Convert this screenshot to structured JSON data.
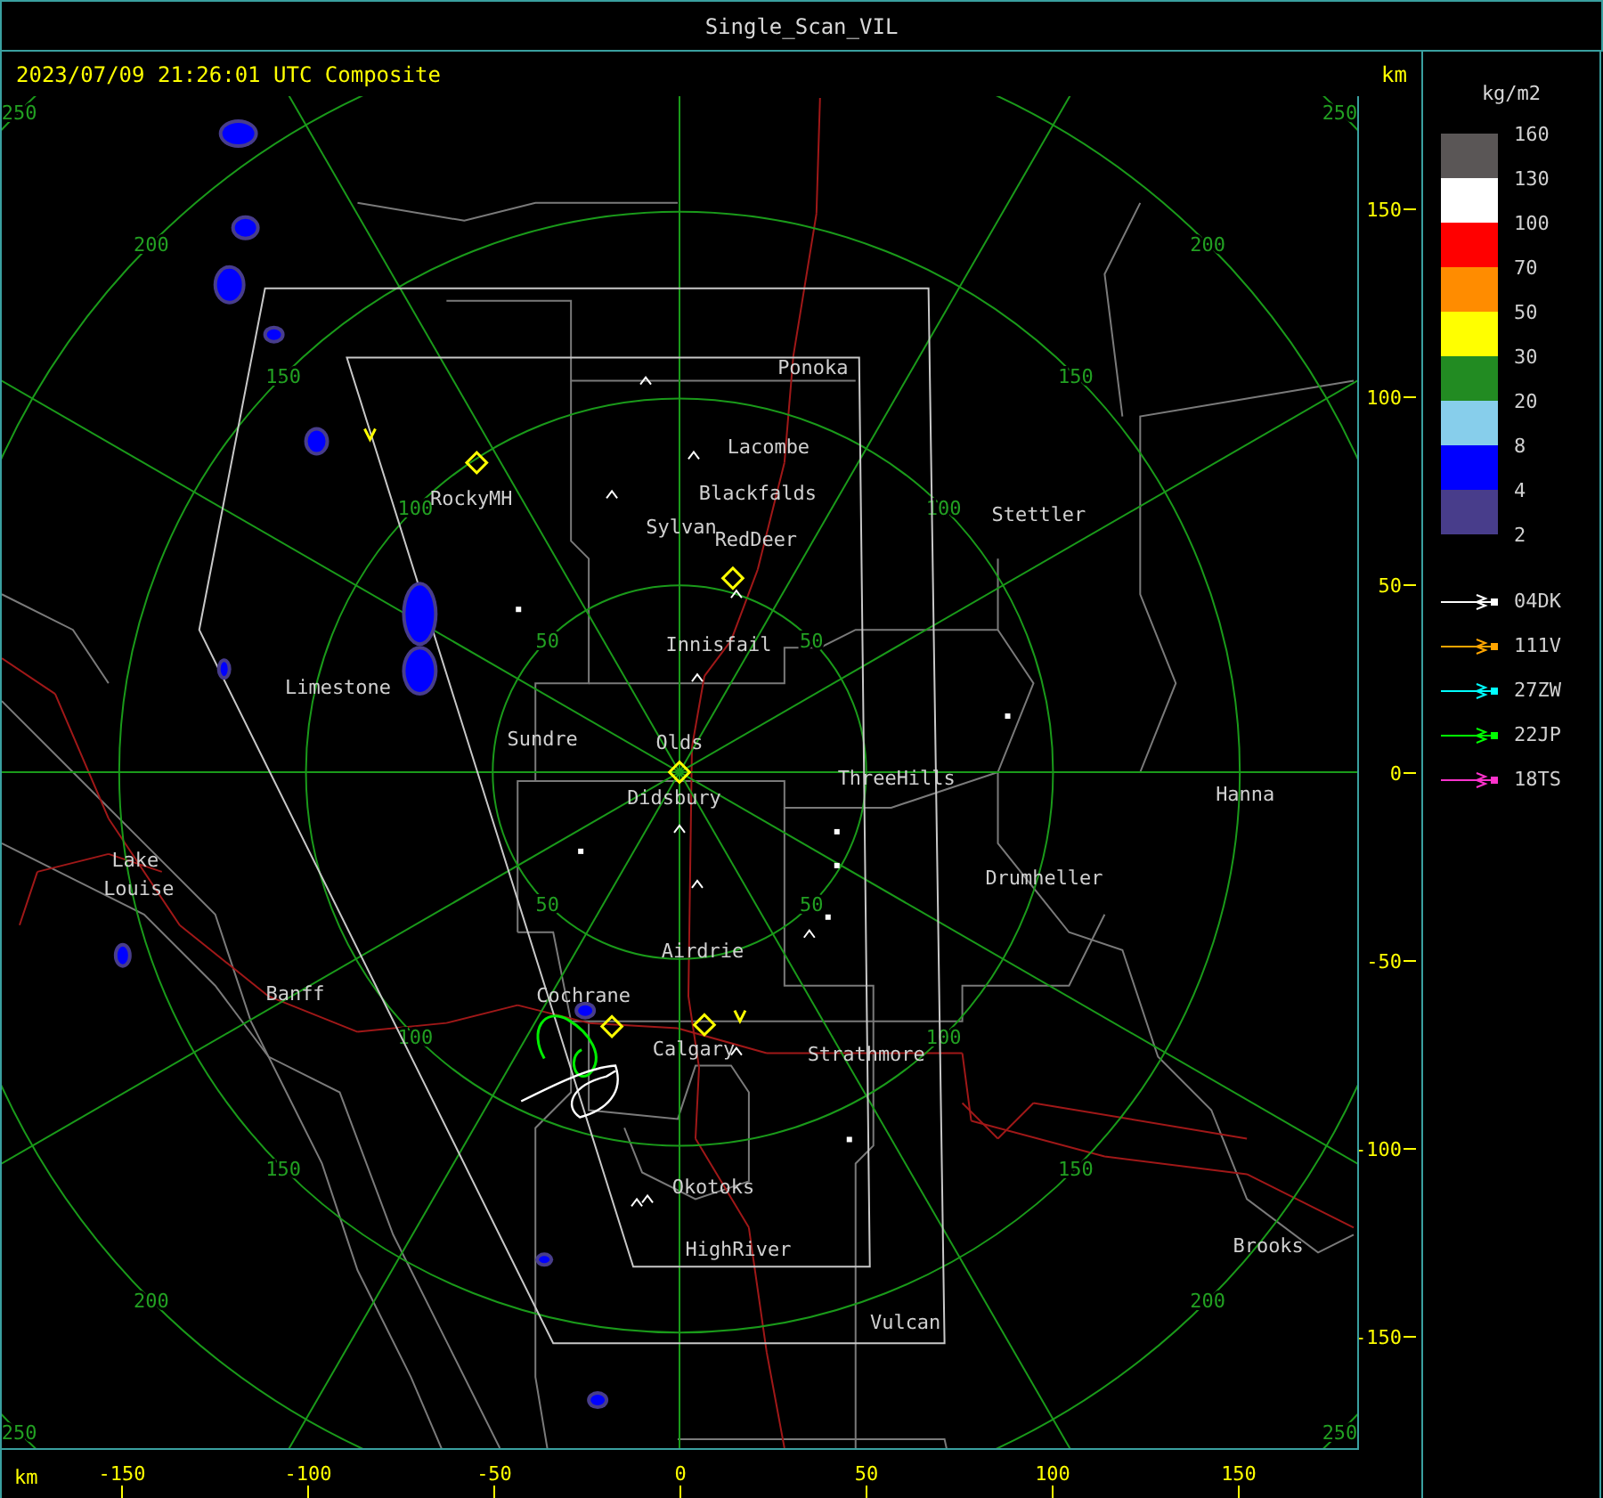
{
  "window": {
    "title": "Single_Scan_VIL"
  },
  "header": {
    "timestamp": "2023/07/09 21:26:01 UTC Composite",
    "unit": "km"
  },
  "map": {
    "range_rings": [
      {
        "labels": [
          "50",
          "50",
          "50",
          "50"
        ]
      },
      {
        "labels": [
          "100",
          "100",
          "100",
          "100"
        ]
      },
      {
        "labels": [
          "150",
          "150",
          "150",
          "150"
        ]
      },
      {
        "labels": [
          "200",
          "200",
          "200",
          "200"
        ]
      },
      {
        "labels": [
          "250",
          "250",
          "250",
          "250"
        ]
      }
    ],
    "places": [
      {
        "name": "Ponoka"
      },
      {
        "name": "Lacombe"
      },
      {
        "name": "Blackfalds"
      },
      {
        "name": "Sylvan"
      },
      {
        "name": "RedDeer"
      },
      {
        "name": "RockyMH"
      },
      {
        "name": "Stettler"
      },
      {
        "name": "Innisfail"
      },
      {
        "name": "Limestone"
      },
      {
        "name": "Sundre"
      },
      {
        "name": "Olds"
      },
      {
        "name": "ThreeHills"
      },
      {
        "name": "Didsbury"
      },
      {
        "name": "Hanna"
      },
      {
        "name": "Lake"
      },
      {
        "name": "Louise"
      },
      {
        "name": "Drumheller"
      },
      {
        "name": "Airdrie"
      },
      {
        "name": "Banff"
      },
      {
        "name": "Cochrane"
      },
      {
        "name": "Calgary"
      },
      {
        "name": "Strathmore"
      },
      {
        "name": "Okotoks"
      },
      {
        "name": "HighRiver"
      },
      {
        "name": "Brooks"
      },
      {
        "name": "Vulcan"
      }
    ]
  },
  "y_axis": {
    "ticks": [
      "150",
      "100",
      "50",
      "0",
      "-50",
      "-100",
      "-150"
    ]
  },
  "x_axis": {
    "unit": "km",
    "ticks": [
      "-150",
      "-100",
      "-50",
      "0",
      "50",
      "100",
      "150"
    ]
  },
  "legend": {
    "unit": "kg/m2",
    "levels": [
      "160",
      "130",
      "100",
      "70",
      "50",
      "30",
      "20",
      "8",
      "4",
      "2"
    ],
    "swatches": [
      {
        "color": "#5a5656"
      },
      {
        "color": "#ffffff"
      },
      {
        "color": "#ff0000"
      },
      {
        "color": "#ff8c00"
      },
      {
        "color": "#ffff00"
      },
      {
        "color": "#228b22"
      },
      {
        "color": "#87ceeb"
      },
      {
        "color": "#0000ff"
      },
      {
        "color": "#483d8b"
      }
    ],
    "tracks": [
      {
        "name": "04DK",
        "color": "#ffffff"
      },
      {
        "name": "111V",
        "color": "#ffa500"
      },
      {
        "name": "27ZW",
        "color": "#00ffff"
      },
      {
        "name": "22JP",
        "color": "#00ff00"
      },
      {
        "name": "18TS",
        "color": "#ff33cc"
      }
    ]
  }
}
